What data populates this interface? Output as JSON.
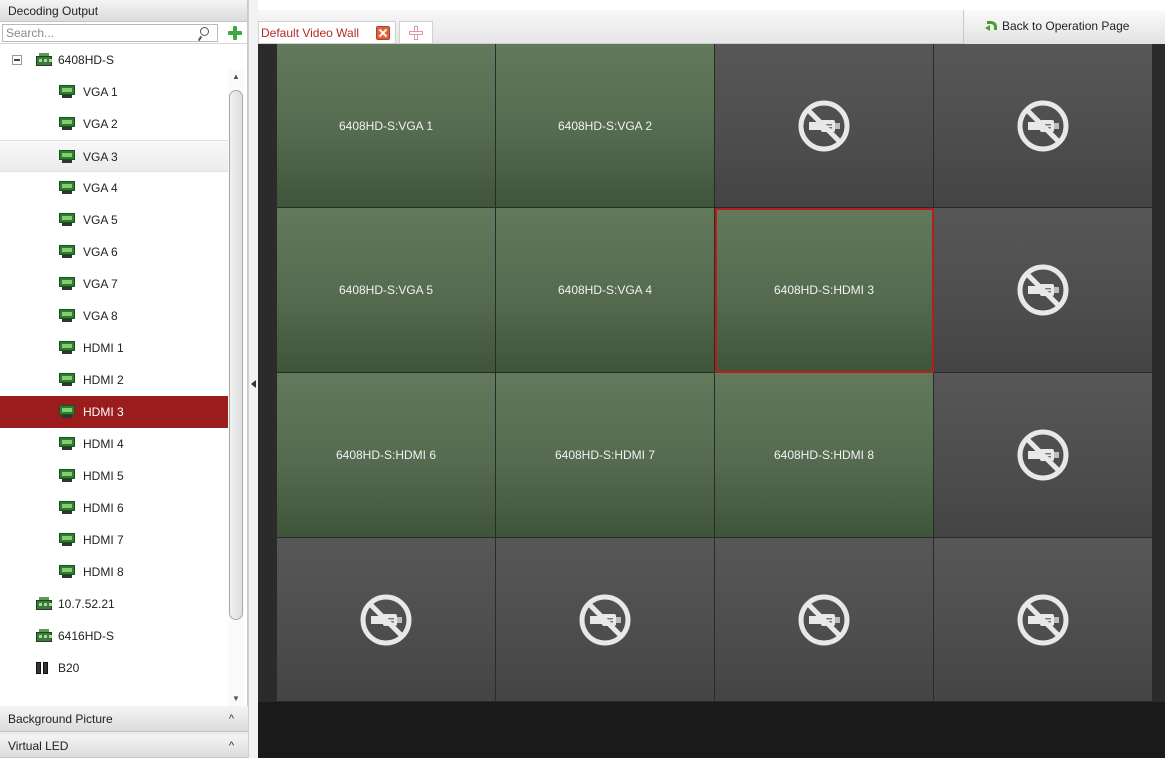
{
  "left_panel": {
    "decoding_output_title": "Decoding Output",
    "search": {
      "placeholder": "Search..."
    },
    "tree": [
      {
        "label": "6408HD-S",
        "level": 0,
        "icon": "device-icon",
        "expanded": true
      },
      {
        "label": "VGA 1",
        "level": 1,
        "icon": "output-icon"
      },
      {
        "label": "VGA 2",
        "level": 1,
        "icon": "output-icon"
      },
      {
        "label": "VGA 3",
        "level": 1,
        "icon": "output-icon",
        "state": "hover"
      },
      {
        "label": "VGA 4",
        "level": 1,
        "icon": "output-icon"
      },
      {
        "label": "VGA 5",
        "level": 1,
        "icon": "output-icon"
      },
      {
        "label": "VGA 6",
        "level": 1,
        "icon": "output-icon"
      },
      {
        "label": "VGA 7",
        "level": 1,
        "icon": "output-icon"
      },
      {
        "label": "VGA 8",
        "level": 1,
        "icon": "output-icon"
      },
      {
        "label": "HDMI 1",
        "level": 1,
        "icon": "output-icon"
      },
      {
        "label": "HDMI 2",
        "level": 1,
        "icon": "output-icon"
      },
      {
        "label": "HDMI 3",
        "level": 1,
        "icon": "output-icon",
        "state": "selected"
      },
      {
        "label": "HDMI 4",
        "level": 1,
        "icon": "output-icon"
      },
      {
        "label": "HDMI 5",
        "level": 1,
        "icon": "output-icon"
      },
      {
        "label": "HDMI 6",
        "level": 1,
        "icon": "output-icon"
      },
      {
        "label": "HDMI 7",
        "level": 1,
        "icon": "output-icon"
      },
      {
        "label": "HDMI 8",
        "level": 1,
        "icon": "output-icon"
      },
      {
        "label": "10.7.52.21",
        "level": 0,
        "icon": "device-icon"
      },
      {
        "label": "6416HD-S",
        "level": 0,
        "icon": "device-icon"
      },
      {
        "label": "B20",
        "level": 0,
        "icon": "b20-icon"
      }
    ],
    "background_picture_title": "Background Picture",
    "virtual_led_title": "Virtual LED",
    "collapse_caret": "^"
  },
  "tabs": {
    "wall_tab_label": "Default Video Wall",
    "back_button_label": "Back to Operation Page"
  },
  "video_wall": {
    "cells": [
      {
        "label": "6408HD-S:VGA 1",
        "status": "active"
      },
      {
        "label": "6408HD-S:VGA 2",
        "status": "active"
      },
      {
        "label": "",
        "status": "no-signal"
      },
      {
        "label": "",
        "status": "no-signal"
      },
      {
        "label": "6408HD-S:VGA 5",
        "status": "active"
      },
      {
        "label": "6408HD-S:VGA 4",
        "status": "active"
      },
      {
        "label": "6408HD-S:HDMI 3",
        "status": "active",
        "selected": true
      },
      {
        "label": "",
        "status": "no-signal"
      },
      {
        "label": "6408HD-S:HDMI 6",
        "status": "active"
      },
      {
        "label": "6408HD-S:HDMI 7",
        "status": "active"
      },
      {
        "label": "6408HD-S:HDMI 8",
        "status": "active"
      },
      {
        "label": "",
        "status": "no-signal"
      },
      {
        "label": "",
        "status": "no-signal"
      },
      {
        "label": "",
        "status": "no-signal"
      },
      {
        "label": "",
        "status": "no-signal"
      },
      {
        "label": "",
        "status": "no-signal"
      }
    ]
  },
  "colors": {
    "selected_row": "#9b1c1c",
    "active_cell": "#5a7054",
    "empty_cell": "#4f4f4f",
    "selection_border": "#b51e1e",
    "tab_text": "#b22a2a"
  }
}
